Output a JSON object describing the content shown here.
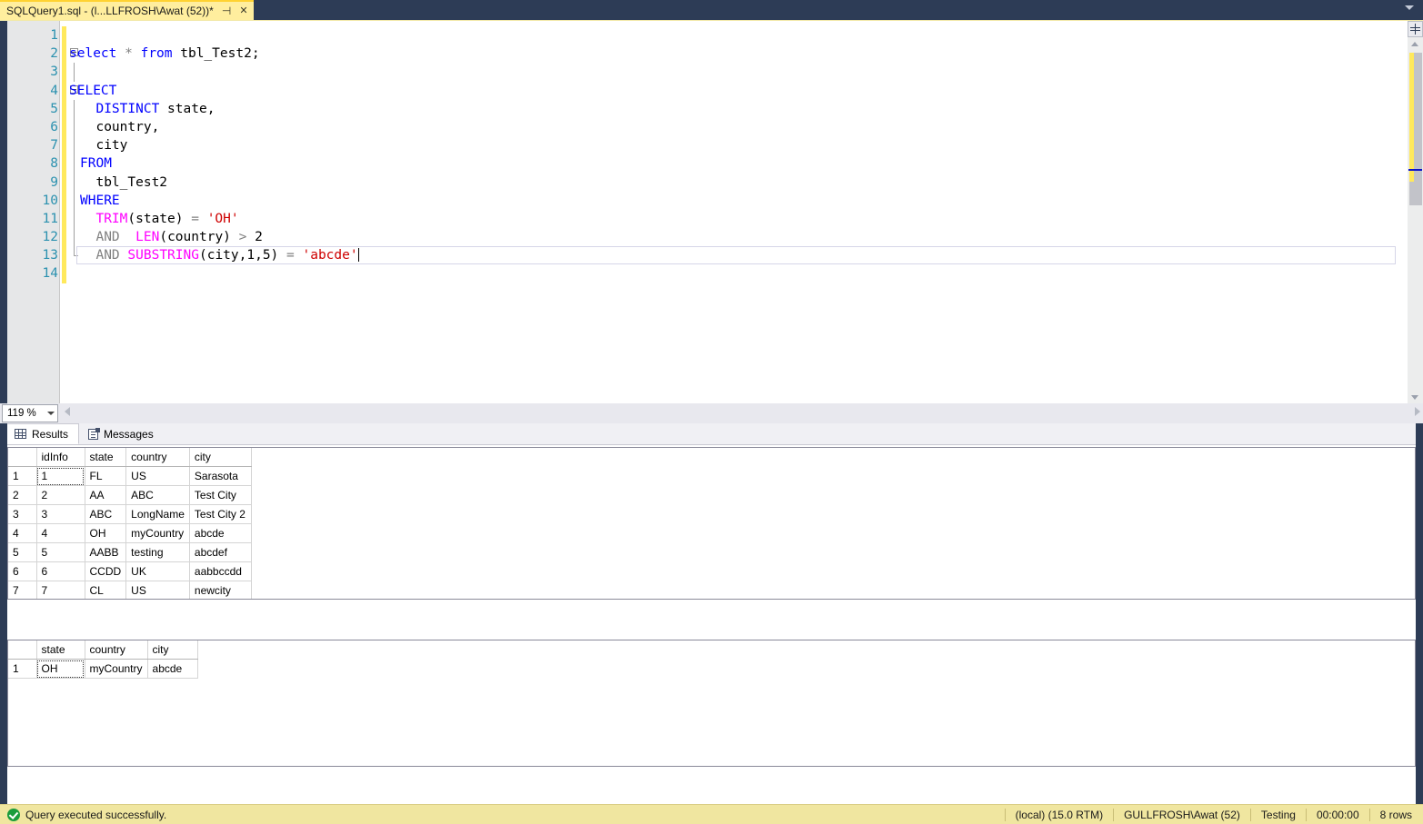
{
  "window": {
    "tab_title": "SQLQuery1.sql - (l...LLFROSH\\Awat (52))*",
    "pin_icon": "pin-icon",
    "close_icon": "close-icon",
    "chevron_icon": "chevron-down-icon"
  },
  "editor": {
    "zoom_level": "119 %",
    "lines": [
      {
        "num": "1",
        "segments": []
      },
      {
        "num": "2",
        "fold": "start",
        "segments": [
          {
            "t": "select",
            "c": "kw"
          },
          {
            "t": " ",
            "c": "plain"
          },
          {
            "t": "*",
            "c": "gray"
          },
          {
            "t": " ",
            "c": "plain"
          },
          {
            "t": "from",
            "c": "kw"
          },
          {
            "t": " tbl_Test2;",
            "c": "plain"
          }
        ]
      },
      {
        "num": "3",
        "fold": "line",
        "segments": []
      },
      {
        "num": "4",
        "fold": "start",
        "segments": [
          {
            "t": "SELECT",
            "c": "kw"
          }
        ]
      },
      {
        "num": "5",
        "fold": "line",
        "indent": true,
        "segments": [
          {
            "t": "  ",
            "c": "plain"
          },
          {
            "t": "DISTINCT",
            "c": "kw"
          },
          {
            "t": " state,",
            "c": "plain"
          }
        ]
      },
      {
        "num": "6",
        "fold": "line",
        "indent": true,
        "segments": [
          {
            "t": "  country,",
            "c": "plain"
          }
        ]
      },
      {
        "num": "7",
        "fold": "line",
        "indent": true,
        "segments": [
          {
            "t": "  city",
            "c": "plain"
          }
        ]
      },
      {
        "num": "8",
        "fold": "line",
        "indent": true,
        "segments": [
          {
            "t": "FROM",
            "c": "kw"
          }
        ]
      },
      {
        "num": "9",
        "fold": "line",
        "indent": true,
        "segments": [
          {
            "t": "  tbl_Test2",
            "c": "plain"
          }
        ]
      },
      {
        "num": "10",
        "fold": "line",
        "indent": true,
        "segments": [
          {
            "t": "WHERE",
            "c": "kw"
          }
        ]
      },
      {
        "num": "11",
        "fold": "line",
        "indent": true,
        "segments": [
          {
            "t": "  ",
            "c": "plain"
          },
          {
            "t": "TRIM",
            "c": "fn"
          },
          {
            "t": "(state) ",
            "c": "plain"
          },
          {
            "t": "=",
            "c": "gray"
          },
          {
            "t": " ",
            "c": "plain"
          },
          {
            "t": "'OH'",
            "c": "str"
          }
        ]
      },
      {
        "num": "12",
        "fold": "line",
        "indent": true,
        "segments": [
          {
            "t": "  ",
            "c": "plain"
          },
          {
            "t": "AND",
            "c": "gray"
          },
          {
            "t": "  ",
            "c": "plain"
          },
          {
            "t": "LEN",
            "c": "fn"
          },
          {
            "t": "(country) ",
            "c": "plain"
          },
          {
            "t": ">",
            "c": "gray"
          },
          {
            "t": " 2",
            "c": "plain"
          }
        ]
      },
      {
        "num": "13",
        "fold": "end",
        "indent": true,
        "current": true,
        "segments": [
          {
            "t": "  ",
            "c": "plain"
          },
          {
            "t": "AND",
            "c": "gray"
          },
          {
            "t": " ",
            "c": "plain"
          },
          {
            "t": "SUBSTRING",
            "c": "fn"
          },
          {
            "t": "(city,1,5) ",
            "c": "plain"
          },
          {
            "t": "=",
            "c": "gray"
          },
          {
            "t": " ",
            "c": "plain"
          },
          {
            "t": "'abcde'",
            "c": "str"
          }
        ]
      },
      {
        "num": "14",
        "segments": []
      }
    ]
  },
  "result_tabs": [
    {
      "label": "Results",
      "icon": "grid-icon",
      "active": true
    },
    {
      "label": "Messages",
      "icon": "messages-icon",
      "active": false
    }
  ],
  "grids": [
    {
      "name": "results-grid-1",
      "columns": [
        "",
        "idInfo",
        "state",
        "country",
        "city"
      ],
      "widths": [
        31,
        53,
        39,
        66,
        68
      ],
      "rows": [
        [
          "1",
          "1",
          "FL",
          "US",
          "Sarasota"
        ],
        [
          "2",
          "2",
          "AA",
          "ABC",
          "Test City"
        ],
        [
          "3",
          "3",
          "ABC",
          "LongName",
          "Test City 2"
        ],
        [
          "4",
          "4",
          "OH",
          "myCountry",
          "abcde"
        ],
        [
          "5",
          "5",
          "AABB",
          "testing",
          "abcdef"
        ],
        [
          "6",
          "6",
          "CCDD",
          "UK",
          "aabbccdd"
        ],
        [
          "7",
          "7",
          "CL",
          "US",
          "newcity"
        ]
      ],
      "selected_cell": {
        "row": 0,
        "col": 1
      }
    },
    {
      "name": "results-grid-2",
      "columns": [
        "",
        "state",
        "country",
        "city"
      ],
      "widths": [
        31,
        53,
        66,
        55
      ],
      "rows": [
        [
          "1",
          "OH",
          "myCountry",
          "abcde"
        ]
      ],
      "selected_cell": {
        "row": 0,
        "col": 1
      }
    }
  ],
  "statusbar": {
    "message": "Query executed successfully.",
    "status_icon": "success-check-icon",
    "server": "(local) (15.0 RTM)",
    "user": "GULLFROSH\\Awat (52)",
    "database": "Testing",
    "elapsed": "00:00:00",
    "rows": "8 rows"
  },
  "colors": {
    "tab_active": "#ffee9e",
    "chrome_dark": "#2d3c56",
    "status_bar": "#f0e6a0",
    "keyword": "#0000ff",
    "function": "#ff00ff",
    "string": "#ce0000",
    "line_number": "#2b91af",
    "change_bar": "#ffe95c",
    "success": "#1a9c3c"
  }
}
